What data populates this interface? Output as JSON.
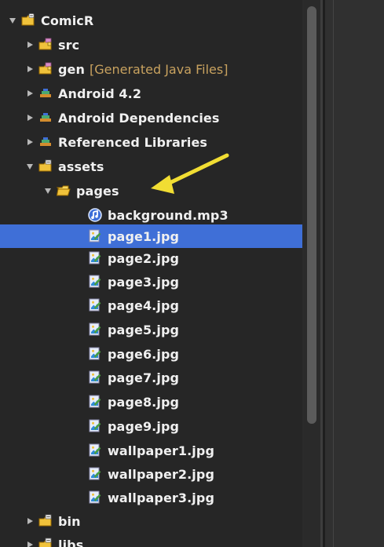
{
  "tree": {
    "items": [
      {
        "label": "ComicR",
        "decorator": ""
      },
      {
        "label": "src",
        "decorator": ""
      },
      {
        "label": "gen",
        "decorator": "[Generated Java Files]"
      },
      {
        "label": "Android 4.2",
        "decorator": ""
      },
      {
        "label": "Android Dependencies",
        "decorator": ""
      },
      {
        "label": "Referenced Libraries",
        "decorator": ""
      },
      {
        "label": "assets",
        "decorator": ""
      },
      {
        "label": "pages",
        "decorator": ""
      },
      {
        "label": "background.mp3",
        "decorator": ""
      },
      {
        "label": "page1.jpg",
        "decorator": ""
      },
      {
        "label": "page2.jpg",
        "decorator": ""
      },
      {
        "label": "page3.jpg",
        "decorator": ""
      },
      {
        "label": "page4.jpg",
        "decorator": ""
      },
      {
        "label": "page5.jpg",
        "decorator": ""
      },
      {
        "label": "page6.jpg",
        "decorator": ""
      },
      {
        "label": "page7.jpg",
        "decorator": ""
      },
      {
        "label": "page8.jpg",
        "decorator": ""
      },
      {
        "label": "page9.jpg",
        "decorator": ""
      },
      {
        "label": "wallpaper1.jpg",
        "decorator": ""
      },
      {
        "label": "wallpaper2.jpg",
        "decorator": ""
      },
      {
        "label": "wallpaper3.jpg",
        "decorator": ""
      },
      {
        "label": "bin",
        "decorator": ""
      },
      {
        "label": "libs",
        "decorator": ""
      }
    ]
  },
  "colors": {
    "selection": "#3f6fd7",
    "decorator": "#c8a25f",
    "annotation_arrow": "#f1dd33",
    "icon_gold": "#f0c23b"
  },
  "icons": {
    "project": "project-folder-icon",
    "package": "package-folder-icon",
    "library": "library-icon",
    "folder": "folder-icon",
    "open_folder": "open-folder-icon",
    "audio": "audio-file-icon",
    "image": "image-file-icon",
    "expanded": "chevron-down-icon",
    "collapsed": "chevron-right-icon",
    "annotation_arrow": "yellow-arrow-icon"
  }
}
